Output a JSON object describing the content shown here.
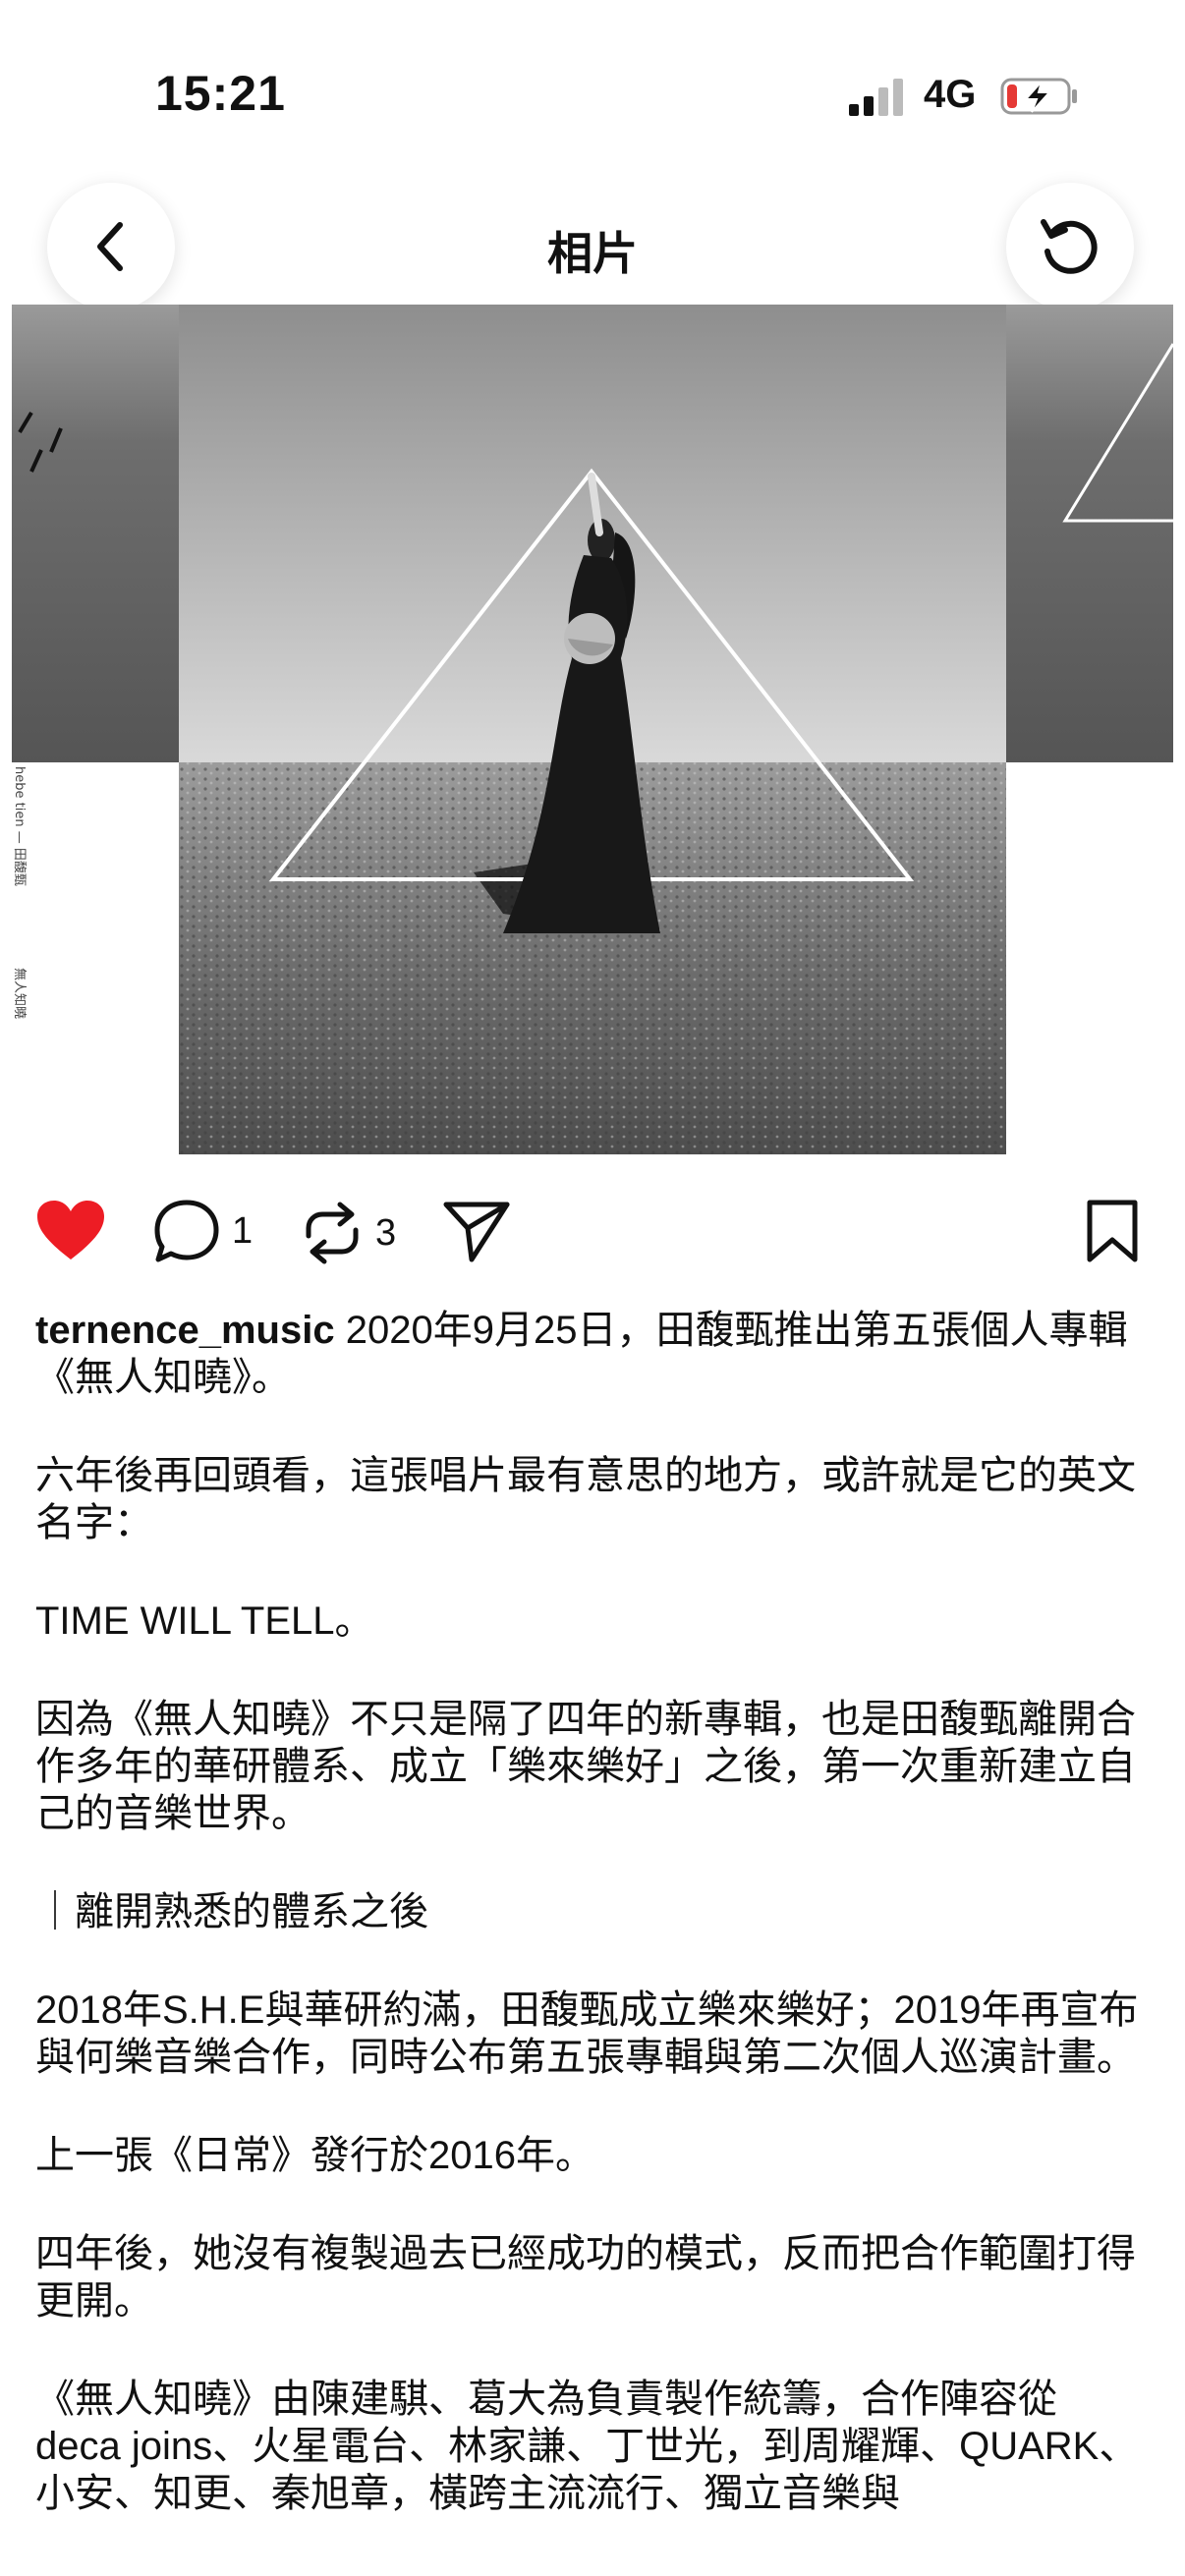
{
  "status": {
    "time": "15:21",
    "network": "4G"
  },
  "header": {
    "title": "相片"
  },
  "photo": {
    "side_vertical_text_1": "hebe tien — 田馥甄",
    "side_vertical_text_2": "無人知曉"
  },
  "actions": {
    "comment_count": "1",
    "repost_count": "3",
    "liked": true
  },
  "post": {
    "username": "ternence_music",
    "intro": "2020年9月25日，田馥甄推出第五張個人專輯《無人知曉》。",
    "paragraphs": [
      "六年後再回頭看，這張唱片最有意思的地方，或許就是它的英文名字：",
      "TIME WILL TELL。",
      "因為《無人知曉》不只是隔了四年的新專輯，也是田馥甄離開合作多年的華研體系、成立「樂來樂好」之後，第一次重新建立自己的音樂世界。",
      "｜離開熟悉的體系之後",
      "2018年S.H.E與華研約滿，田馥甄成立樂來樂好；2019年再宣布與何樂音樂合作，同時公布第五張專輯與第二次個人巡演計畫。",
      "上一張《日常》發行於2016年。",
      "四年後，她沒有複製過去已經成功的模式，反而把合作範圍打得更開。",
      "《無人知曉》由陳建騏、葛大為負責製作統籌，合作陣容從 deca joins、火星電台、林家謙、丁世光，到周耀輝、QUARK、小安、知更、秦旭章，橫跨主流流行、獨立音樂與"
    ]
  },
  "colors": {
    "like": "#ed1c24",
    "text": "#111111",
    "battery_low": "#e53935"
  }
}
